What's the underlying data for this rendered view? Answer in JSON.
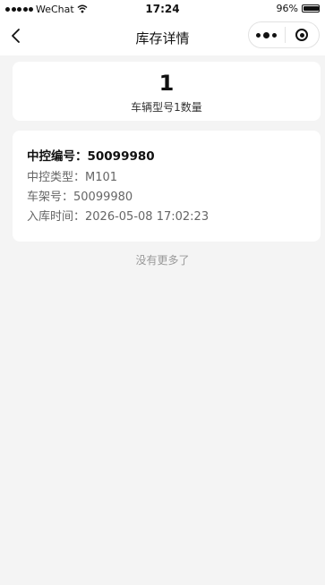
{
  "status_bar": {
    "carrier": "WeChat",
    "time": "17:24",
    "battery": "96%"
  },
  "nav": {
    "title": "库存详情"
  },
  "summary": {
    "count": "1",
    "label": "车辆型号1数量"
  },
  "detail": {
    "control_no_label": "中控编号：",
    "control_no_value": "50099980",
    "control_type_label": "中控类型：",
    "control_type_value": "M101",
    "frame_no_label": "车架号：",
    "frame_no_value": "50099980",
    "stock_time_label": "入库时间：",
    "stock_time_value": "2026-05-08 17:02:23"
  },
  "footer": {
    "no_more": "没有更多了"
  }
}
